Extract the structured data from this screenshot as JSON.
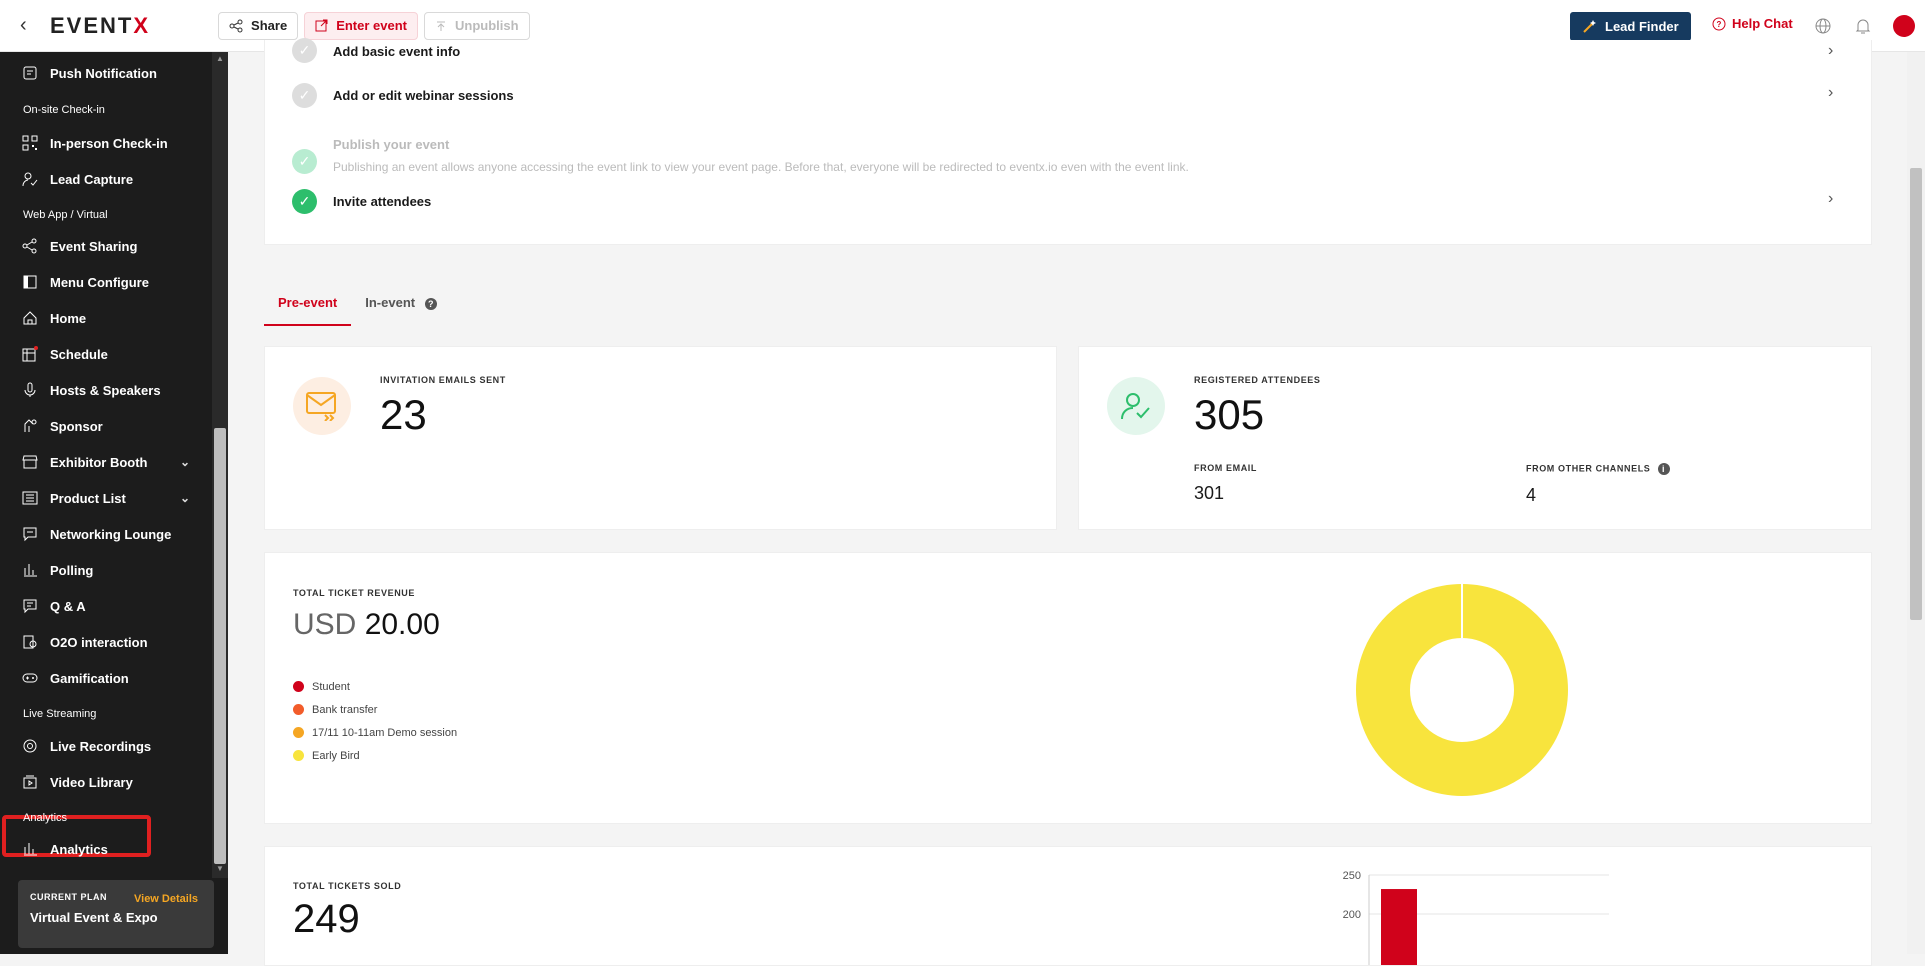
{
  "topbar": {
    "logo_main": "EVENT",
    "logo_x": "X",
    "share_label": "Share",
    "enter_label": "Enter event",
    "unpublish_label": "Unpublish",
    "lead_finder_label": "Lead Finder",
    "help_chat_label": "Help Chat"
  },
  "sidebar": {
    "items": [
      {
        "label": "Push Notification",
        "icon": "push-icon"
      },
      {
        "label": "In-person Check-in",
        "icon": "qr-icon"
      },
      {
        "label": "Lead Capture",
        "icon": "lead-capture-icon"
      },
      {
        "label": "Event Sharing",
        "icon": "share-icon"
      },
      {
        "label": "Menu Configure",
        "icon": "menu-config-icon"
      },
      {
        "label": "Home",
        "icon": "home-icon"
      },
      {
        "label": "Schedule",
        "icon": "schedule-icon"
      },
      {
        "label": "Hosts & Speakers",
        "icon": "mic-icon"
      },
      {
        "label": "Sponsor",
        "icon": "sponsor-icon"
      },
      {
        "label": "Exhibitor Booth",
        "icon": "booth-icon"
      },
      {
        "label": "Product List",
        "icon": "list-icon"
      },
      {
        "label": "Networking Lounge",
        "icon": "chat-icon"
      },
      {
        "label": "Polling",
        "icon": "poll-icon"
      },
      {
        "label": "Q & A",
        "icon": "qa-icon"
      },
      {
        "label": "O2O interaction",
        "icon": "o2o-icon"
      },
      {
        "label": "Gamification",
        "icon": "gamepad-icon"
      },
      {
        "label": "Live Recordings",
        "icon": "record-icon"
      },
      {
        "label": "Video Library",
        "icon": "video-library-icon"
      },
      {
        "label": "Analytics",
        "icon": "analytics-icon"
      }
    ],
    "sections": [
      "On-site Check-in",
      "Web App / Virtual",
      "Live Streaming",
      "Analytics"
    ],
    "plan": {
      "label": "CURRENT PLAN",
      "view_details": "View Details",
      "name": "Virtual Event & Expo"
    }
  },
  "checklist": {
    "items": [
      {
        "title": "Add basic event info",
        "desc": ""
      },
      {
        "title": "Add or edit webinar sessions",
        "desc": ""
      },
      {
        "title": "Publish your event",
        "desc": "Publishing an event allows anyone accessing the event link to view your event page. Before that, everyone will be redirected to eventx.io even with the event link."
      },
      {
        "title": "Invite attendees",
        "desc": ""
      }
    ]
  },
  "tabs": [
    "Pre-event",
    "In-event"
  ],
  "stats": {
    "invitations": {
      "label": "INVITATION EMAILS SENT",
      "value": "23"
    },
    "registered": {
      "label": "REGISTERED ATTENDEES",
      "value": "305",
      "from_email_label": "FROM EMAIL",
      "from_email_value": "301",
      "from_other_label": "FROM OTHER CHANNELS",
      "from_other_value": "4"
    }
  },
  "revenue": {
    "label": "TOTAL TICKET REVENUE",
    "currency": "USD",
    "amount": "20.00",
    "legend": [
      {
        "name": "Student",
        "color": "#d0021b"
      },
      {
        "name": "Bank transfer",
        "color": "#f25c2a"
      },
      {
        "name": "17/11 10-11am Demo session",
        "color": "#f5a623"
      },
      {
        "name": "Early Bird",
        "color": "#f8e43d"
      }
    ]
  },
  "tickets": {
    "label": "TOTAL TICKETS SOLD",
    "value": "249"
  },
  "chart_data": [
    {
      "type": "pie",
      "title": "",
      "categories": [
        "Student",
        "Bank transfer",
        "17/11 10-11am Demo session",
        "Early Bird"
      ],
      "values": [
        0,
        0,
        0,
        20
      ],
      "colors": [
        "#d0021b",
        "#f25c2a",
        "#f5a623",
        "#f8e43d"
      ]
    },
    {
      "type": "bar",
      "title": "",
      "categories": [
        "Student"
      ],
      "values": [
        232
      ],
      "ylim": [
        0,
        250
      ],
      "yticks": [
        "250",
        "200"
      ]
    }
  ]
}
